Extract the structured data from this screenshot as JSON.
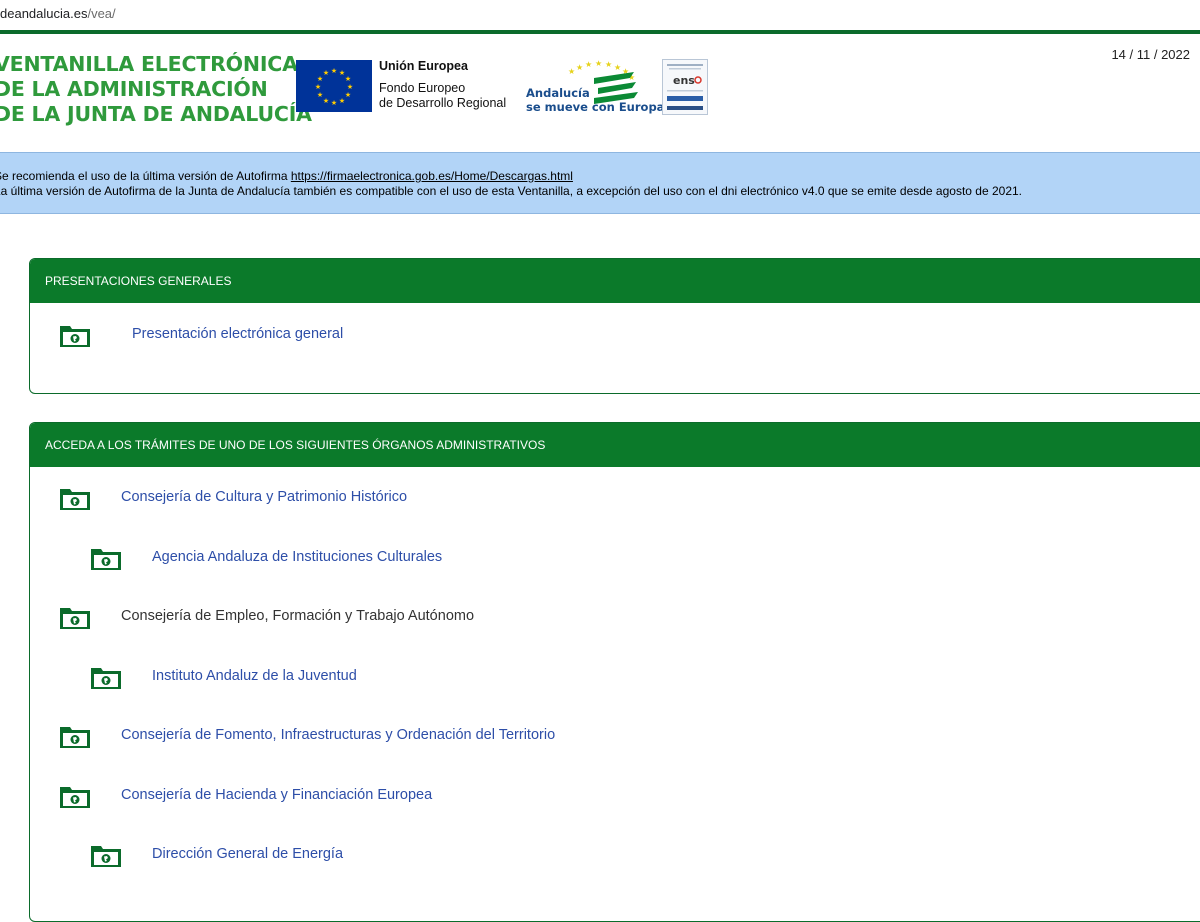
{
  "browser": {
    "url_host": "deandalucia.es",
    "url_path": "/vea/"
  },
  "header": {
    "title_lines": [
      "VENTANILLA ELECTRÓNICA",
      "DE LA ADMINISTRACIÓN",
      "DE LA JUNTA DE ANDALUCÍA"
    ],
    "eu_name": "Unión Europea",
    "eu_fund_line1": "Fondo Europeo",
    "eu_fund_line2": "de Desarrollo Regional",
    "andalucia_line1": "Andalucía",
    "andalucia_line2": "se mueve con Europa",
    "ens_text": "ens",
    "date": "14 / 11 / 2022"
  },
  "notice": {
    "line1_text": "Se recomienda el uso de la última versión de Autofirma ",
    "line1_link": "https://firmaelectronica.gob.es/Home/Descargas.html",
    "line2_text": "La última versión de Autofirma de la Junta de Andalucía también es compatible con el uso de esta Ventanilla, a excepción del uso con el dni electrónico v4.0 que se emite desde agosto de 2021."
  },
  "panels": [
    {
      "title": "PRESENTACIONES GENERALES",
      "items": [
        {
          "label": "Presentación electrónica general",
          "level": 0,
          "link": true
        }
      ]
    },
    {
      "title": "ACCEDA A LOS TRÁMITES DE UNO DE LOS SIGUIENTES ÓRGANOS ADMINISTRATIVOS",
      "items": [
        {
          "label": "Consejería de Cultura y Patrimonio Histórico",
          "level": 0,
          "link": true
        },
        {
          "label": "Agencia Andaluza de Instituciones Culturales",
          "level": 1,
          "link": true
        },
        {
          "label": "Consejería de Empleo, Formación y Trabajo Autónomo",
          "level": 0,
          "link": false
        },
        {
          "label": "Instituto Andaluz de la Juventud",
          "level": 1,
          "link": true
        },
        {
          "label": "Consejería de Fomento, Infraestructuras y Ordenación del Territorio",
          "level": 0,
          "link": true
        },
        {
          "label": "Consejería de Hacienda y Financiación Europea",
          "level": 0,
          "link": true
        },
        {
          "label": "Dirección General de Energía",
          "level": 1,
          "link": true
        }
      ]
    }
  ],
  "icons": {
    "folder": "folder-globe-icon",
    "eu_flag": "eu-flag-icon",
    "andalucia": "andalucia-logo-icon",
    "ens": "ens-badge-icon"
  },
  "colors": {
    "brand_green": "#0b7a2a",
    "title_green": "#2f9a3c",
    "link_blue": "#2d4ea8",
    "notice_bg": "#b2d4f7",
    "eu_blue": "#003399"
  }
}
